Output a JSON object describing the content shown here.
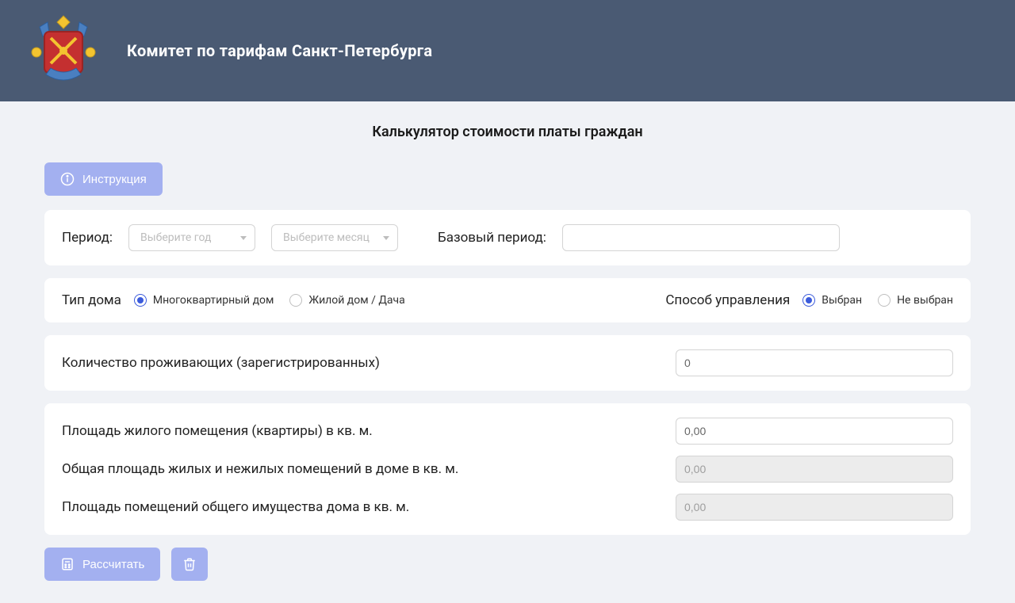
{
  "header": {
    "title": "Комитет по тарифам Санкт-Петербурга"
  },
  "page": {
    "title": "Калькулятор стоимости платы граждан"
  },
  "buttons": {
    "instruction": "Инструкция",
    "calculate": "Рассчитать"
  },
  "period": {
    "label": "Период:",
    "year_placeholder": "Выберите год",
    "month_placeholder": "Выберите месяц",
    "base_label": "Базовый период:",
    "base_value": ""
  },
  "house_type": {
    "label": "Тип дома",
    "opt1": "Многоквартирный дом",
    "opt2": "Жилой дом / Дача",
    "selected": "opt1"
  },
  "management": {
    "label": "Способ управления",
    "opt1": "Выбран",
    "opt2": "Не выбран",
    "selected": "opt1"
  },
  "residents": {
    "label": "Количество проживающих (зарегистрированных)",
    "value": "0"
  },
  "area": {
    "living": {
      "label": "Площадь жилого помещения (квартиры) в кв. м.",
      "value": "0,00"
    },
    "total": {
      "label": "Общая площадь жилых и нежилых помещений в доме в кв. м.",
      "value": "0,00"
    },
    "common": {
      "label": "Площадь помещений общего имущества дома в кв. м.",
      "value": "0,00"
    }
  }
}
